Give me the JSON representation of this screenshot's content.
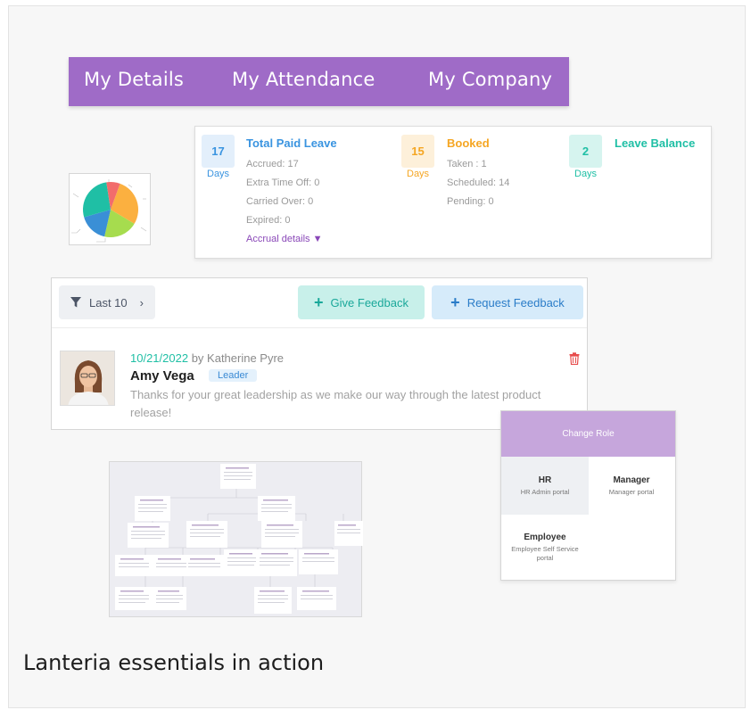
{
  "nav": {
    "items": [
      "My Details",
      "My Attendance",
      "My Company"
    ]
  },
  "leave": {
    "paid": {
      "count": "17",
      "unit": "Days",
      "title": "Total Paid Leave",
      "lines": [
        "Accrued: 17",
        "Extra Time Off: 0",
        "Carried Over: 0",
        "Expired: 0"
      ],
      "link": "Accrual details ▼"
    },
    "booked": {
      "count": "15",
      "unit": "Days",
      "title": "Booked",
      "lines": [
        "Taken : 1",
        "Scheduled: 14",
        "Pending: 0"
      ]
    },
    "balance": {
      "count": "2",
      "unit": "Days",
      "title": "Leave Balance"
    }
  },
  "pie": {
    "slices": [
      {
        "value": 28,
        "color": "#fbb040"
      },
      {
        "value": 20,
        "color": "#a6dc4e"
      },
      {
        "value": 17,
        "color": "#3a8fd6"
      },
      {
        "value": 27,
        "color": "#1fbfa5"
      },
      {
        "value": 8,
        "color": "#f26c6c"
      }
    ]
  },
  "feedback": {
    "filter_label": "Last 10",
    "give_label": "Give Feedback",
    "request_label": "Request Feedback",
    "date": "10/21/2022",
    "by": "by Katherine Pyre",
    "name": "Amy Vega",
    "tag": "Leader",
    "message": "Thanks for your great leadership as we make our way through the latest product release!"
  },
  "role": {
    "title": "Change Role",
    "options": [
      {
        "name": "HR",
        "desc": "HR Admin portal"
      },
      {
        "name": "Manager",
        "desc": "Manager portal"
      },
      {
        "name": "Employee",
        "desc": "Employee Self Service portal"
      }
    ]
  },
  "caption": "Lanteria essentials in action",
  "colors": {
    "purple": "#9f6bc7",
    "blue": "#3a94e0",
    "orange": "#f5a623",
    "teal": "#1fbfa5"
  }
}
